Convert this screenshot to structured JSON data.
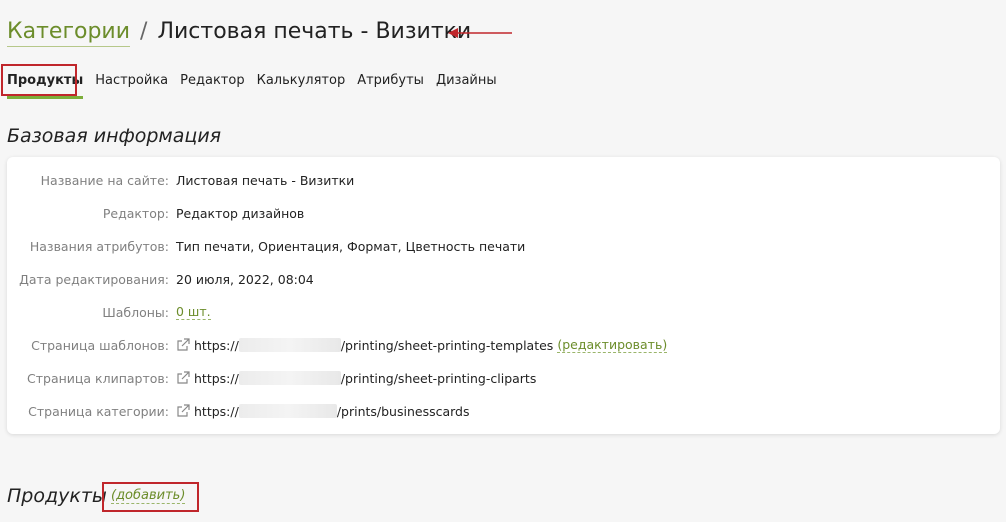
{
  "header": {
    "breadcrumb_link": "Категории",
    "separator": "/",
    "title": "Листовая печать - Визитки"
  },
  "tabs": [
    {
      "label": "Продукты",
      "active": true
    },
    {
      "label": "Настройка"
    },
    {
      "label": "Редактор"
    },
    {
      "label": "Калькулятор"
    },
    {
      "label": "Атрибуты"
    },
    {
      "label": "Дизайны"
    }
  ],
  "basic_info": {
    "title": "Базовая информация",
    "rows": [
      {
        "label": "Название на сайте:",
        "value": "Листовая печать - Визитки"
      },
      {
        "label": "Редактор:",
        "value": "Редактор дизайнов"
      },
      {
        "label": "Названия атрибутов:",
        "value": "Тип печати, Ориентация, Формат, Цветность печати"
      },
      {
        "label": "Дата редактирования:",
        "value": "20 июля, 2022, 08:04"
      },
      {
        "label": "Шаблоны:",
        "value": "0 шт."
      },
      {
        "label": "Страница шаблонов:",
        "url_prefix": "https://",
        "url_suffix": "/printing/sheet-printing-templates",
        "edit_label": "(редактировать)"
      },
      {
        "label": "Страница клипартов:",
        "url_prefix": "https://",
        "url_suffix": "/printing/sheet-printing-cliparts"
      },
      {
        "label": "Страница категории:",
        "url_prefix": "https://",
        "url_suffix": "/prints/businesscards"
      }
    ]
  },
  "products": {
    "title": "Продукты",
    "add_label": "(добавить)"
  },
  "colors": {
    "accent": "#6c8d2b",
    "highlight": "#c0262b",
    "tab_underline": "#7cae3a"
  }
}
